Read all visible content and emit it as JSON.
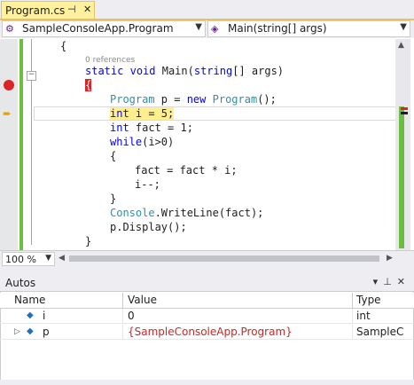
{
  "tab": {
    "title": "Program.cs",
    "pin_icon": "pin-icon",
    "close_icon": "close-icon"
  },
  "navbar": {
    "type_selector": "SampleConsoleApp.Program",
    "member_selector": "Main(string[] args)"
  },
  "code": {
    "references": "0 references",
    "lines": {
      "open_brace_class": "{",
      "main_sig": [
        "static",
        " ",
        "void",
        " Main(",
        "string",
        "[] args)"
      ],
      "open_brace_main": "{",
      "line1": [
        "Program",
        " p = ",
        "new",
        " ",
        "Program",
        "();"
      ],
      "line2": [
        "int",
        " i = 5;"
      ],
      "line3": [
        "int",
        " fact = 1;"
      ],
      "line4": [
        "while",
        "(i>0)"
      ],
      "line5": "{",
      "line6": "fact = fact * i;",
      "line7": "i--;",
      "line8": "}",
      "line9": [
        "Console",
        ".WriteLine(fact);"
      ],
      "line10": "p.Display();",
      "line11": "}"
    }
  },
  "zoom": {
    "value": "100 %"
  },
  "autos": {
    "title": "Autos",
    "columns": [
      "Name",
      "Value",
      "Type"
    ],
    "rows": [
      {
        "name": "i",
        "value": "0",
        "type": "int",
        "changed": false
      },
      {
        "name": "p",
        "value": "{SampleConsoleApp.Program}",
        "type": "SampleC",
        "changed": true
      }
    ]
  },
  "colors": {
    "breakpoint": "#d9242a",
    "current_stmt": "#ffef8f",
    "keyword": "#0000ff",
    "type": "#2b91af",
    "changed_value": "#c62828"
  }
}
